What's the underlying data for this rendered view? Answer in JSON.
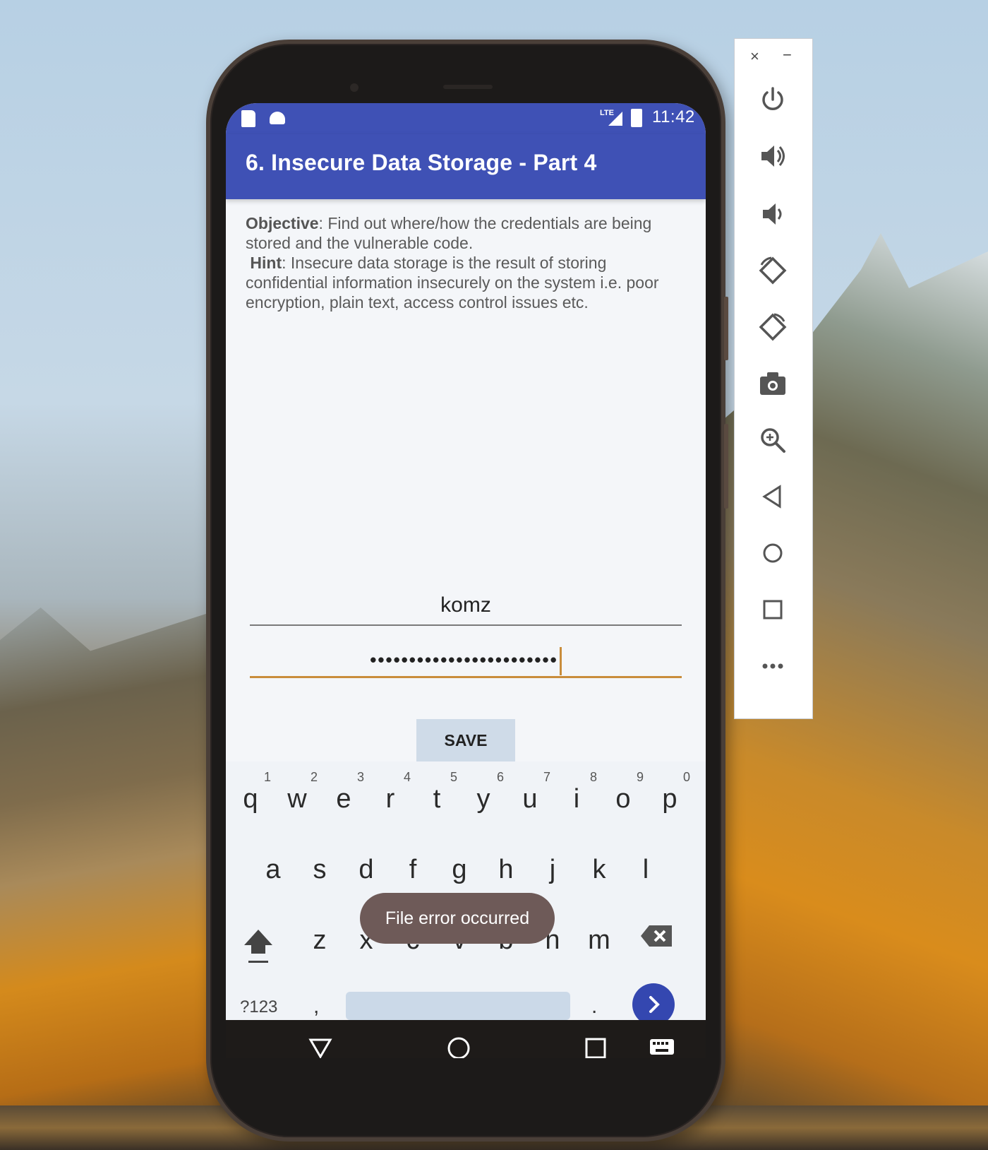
{
  "status_bar": {
    "network": "LTE",
    "time": "11:42"
  },
  "app_bar": {
    "title": "6. Insecure Data Storage - Part 4"
  },
  "content": {
    "objective_label": "Objective",
    "objective_text": ": Find out where/how the credentials are being stored and the vulnerable code.",
    "hint_label": "Hint",
    "hint_text": ": Insecure data storage is the result of storing confidential information insecurely on the system i.e. poor encryption, plain text, access control issues etc."
  },
  "form": {
    "username_value": "komz",
    "password_value": "••••••••••••••••••••••••",
    "save_label": "SAVE"
  },
  "keyboard": {
    "row1": [
      {
        "ch": "q",
        "hint": "1"
      },
      {
        "ch": "w",
        "hint": "2"
      },
      {
        "ch": "e",
        "hint": "3"
      },
      {
        "ch": "r",
        "hint": "4"
      },
      {
        "ch": "t",
        "hint": "5"
      },
      {
        "ch": "y",
        "hint": "6"
      },
      {
        "ch": "u",
        "hint": "7"
      },
      {
        "ch": "i",
        "hint": "8"
      },
      {
        "ch": "o",
        "hint": "9"
      },
      {
        "ch": "p",
        "hint": "0"
      }
    ],
    "row2": [
      "a",
      "s",
      "d",
      "f",
      "g",
      "h",
      "j",
      "k",
      "l"
    ],
    "row3": [
      "z",
      "x",
      "c",
      "v",
      "b",
      "n",
      "m"
    ],
    "symbols_label": "?123",
    "comma_label": ",",
    "period_label": "."
  },
  "toast": {
    "message": "File error occurred"
  },
  "emulator_panel": {
    "close_label": "×",
    "minimize_label": "−",
    "tools": [
      "power-icon",
      "volume-up-icon",
      "volume-down-icon",
      "rotate-left-icon",
      "rotate-right-icon",
      "camera-icon",
      "zoom-icon",
      "back-icon",
      "home-icon",
      "overview-icon",
      "more-icon"
    ]
  },
  "colors": {
    "primary": "#3f51b5",
    "accent": "#c98d3c",
    "toast_bg": "#6e5a58"
  }
}
